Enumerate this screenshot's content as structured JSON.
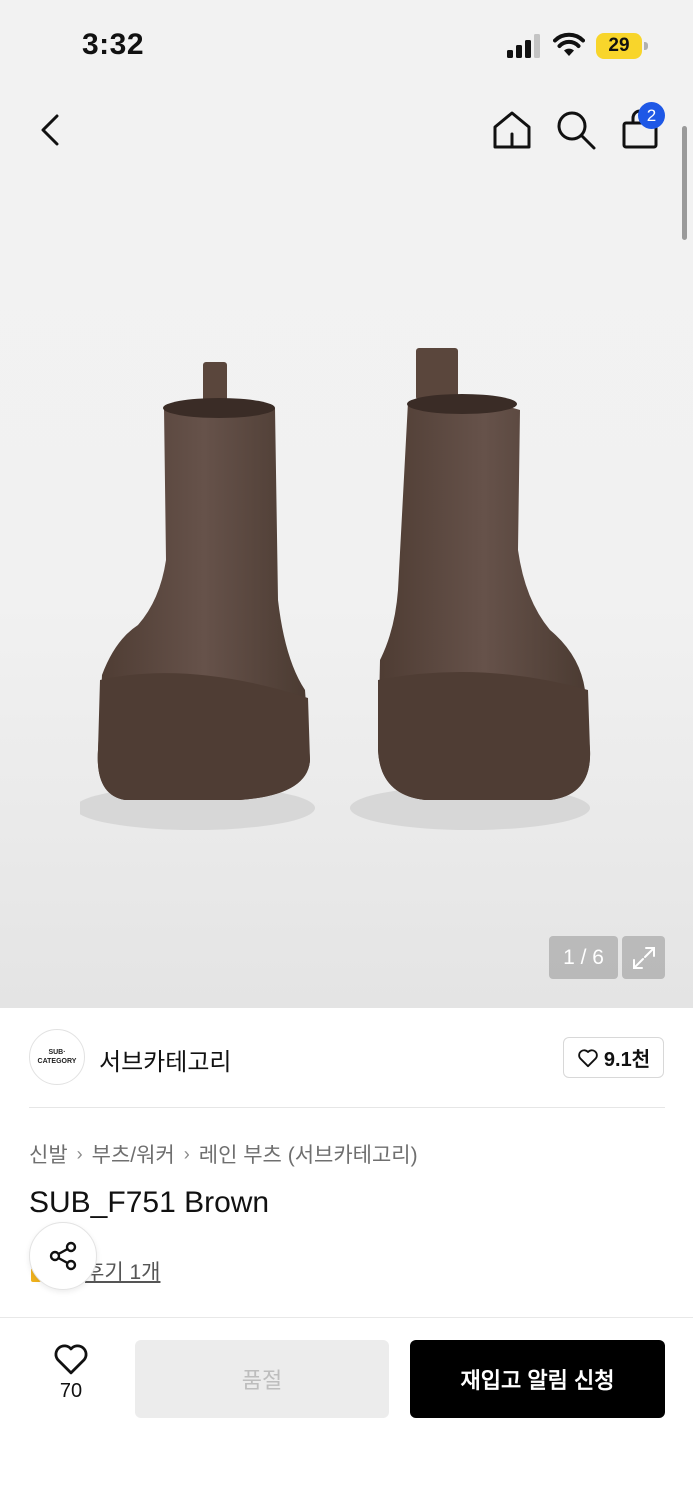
{
  "status_bar": {
    "time": "3:32",
    "battery": "29"
  },
  "nav": {
    "cart_count": "2"
  },
  "gallery": {
    "counter": "1 / 6"
  },
  "brand": {
    "logo_line1": "SUB·",
    "logo_line2": "CATEGORY",
    "name": "서브카테고리",
    "likes": "9.1천"
  },
  "breadcrumb": [
    "신발",
    "부츠/워커",
    "레인 부츠 (서브카테고리)"
  ],
  "product": {
    "title": "SUB_F751 Brown",
    "review_link": "후기 1개"
  },
  "bottom_bar": {
    "wish_count": "70",
    "soldout_label": "품절",
    "restock_label": "재입고 알림 신청"
  },
  "colors": {
    "accent_badge": "#1e58e6",
    "battery": "#f8d52b",
    "boot_brown": "#5a463c"
  }
}
